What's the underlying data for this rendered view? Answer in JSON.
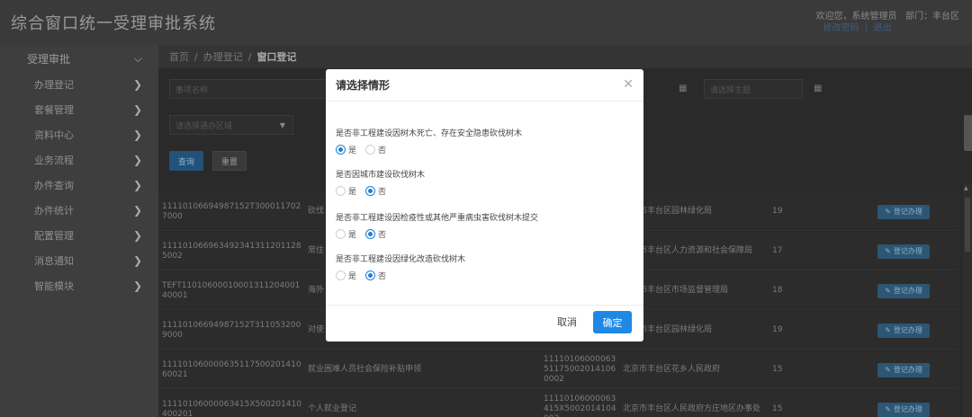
{
  "header": {
    "title": "综合窗口统一受理审批系统",
    "welcome": "欢迎您，系统管理员",
    "department": "部门：丰台区",
    "change_password": "修改密码",
    "separator": "|",
    "logout": "退出"
  },
  "sidebar": {
    "section": "受理审批",
    "section_icon": "chevron-down-icon",
    "items": [
      {
        "label": "办理登记"
      },
      {
        "label": "套餐管理"
      },
      {
        "label": "资料中心"
      },
      {
        "label": "业务流程"
      },
      {
        "label": "办件查询"
      },
      {
        "label": "办件统计"
      },
      {
        "label": "配置管理"
      },
      {
        "label": "消息通知"
      },
      {
        "label": "智能模块"
      }
    ]
  },
  "breadcrumb": {
    "home": "首页",
    "level1": "办理登记",
    "current": "窗口登记",
    "sep": "/"
  },
  "filters": {
    "item_name_placeholder": "事项名称",
    "subject_placeholder": "请选择主题",
    "area_placeholder": "请选择通办区域",
    "query_button": "查询",
    "reset_button": "重置"
  },
  "table": {
    "rows": [
      {
        "code": "11110106694987152T3000117027000",
        "name": "砍伐",
        "item_code": "",
        "dept": "北京市丰台区园林绿化局",
        "count": "19",
        "action": "登记办理"
      },
      {
        "code": "1111010669634923413112011285002",
        "name": "常住",
        "item_code": "",
        "dept": "北京市丰台区人力资源和社会保障局",
        "count": "17",
        "action": "登记办理"
      },
      {
        "code": "TEFT1101060001000131120400140001",
        "name": "海外",
        "item_code": "",
        "dept": "北京市丰台区市场监督管理局",
        "count": "18",
        "action": "登记办理"
      },
      {
        "code": "11110106694987152T3110532009000",
        "name": "对使",
        "item_code": "",
        "dept": "北京市丰台区园林绿化局",
        "count": "19",
        "action": "登记办理"
      },
      {
        "code": "11110106000063511750020141060021",
        "name": "就业困难人员社会保险补贴申领",
        "item_code": "11110106000063511750020141060002",
        "dept": "北京市丰台区花乡人民政府",
        "count": "15",
        "action": "登记办理"
      },
      {
        "code": "11110106000063415X500201410400201",
        "name": "个人就业登记",
        "item_code": "11110106000063415X5002014104002",
        "dept": "北京市丰台区人民政府方庄地区办事处",
        "count": "15",
        "action": "登记办理"
      }
    ]
  },
  "modal": {
    "title": "请选择情形",
    "close_icon": "close-icon",
    "questions": [
      {
        "text": "是否非工程建设因树木死亡、存在安全隐患砍伐树木",
        "yes": "是",
        "no": "否",
        "selected": "yes"
      },
      {
        "text": "是否因城市建设砍伐树木",
        "yes": "是",
        "no": "否",
        "selected": "no"
      },
      {
        "text": "是否非工程建设因检疫性或其他严重病虫害砍伐树木提交",
        "yes": "是",
        "no": "否",
        "selected": "no"
      },
      {
        "text": "是否非工程建设因绿化改造砍伐树木",
        "yes": "是",
        "no": "否",
        "selected": "no"
      }
    ],
    "cancel": "取消",
    "confirm": "确定"
  },
  "colors": {
    "primary": "#1e88e5",
    "header_bg": "#3a3a3a",
    "sidebar_bg": "#3e3e3e"
  }
}
